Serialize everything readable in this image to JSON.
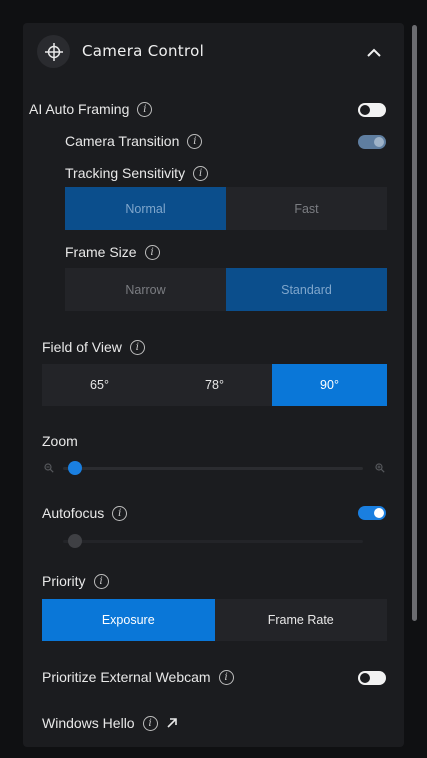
{
  "header": {
    "title": "Camera Control",
    "icon": "crosshair-icon",
    "collapse_icon": "chevron-up-icon"
  },
  "ai_auto_framing": {
    "label": "AI Auto Framing",
    "enabled": false,
    "camera_transition": {
      "label": "Camera Transition",
      "enabled": true,
      "disabled_look": true
    },
    "tracking_sensitivity": {
      "label": "Tracking Sensitivity",
      "options": [
        "Normal",
        "Fast"
      ],
      "selected": "Normal"
    },
    "frame_size": {
      "label": "Frame Size",
      "options": [
        "Narrow",
        "Standard"
      ],
      "selected": "Standard"
    }
  },
  "field_of_view": {
    "label": "Field of View",
    "options": [
      "65°",
      "78°",
      "90°"
    ],
    "selected": "90°"
  },
  "zoom": {
    "label": "Zoom",
    "value_fraction": 0.0
  },
  "autofocus": {
    "label": "Autofocus",
    "enabled": true,
    "focus_value_fraction": 0.0
  },
  "priority": {
    "label": "Priority",
    "options": [
      "Exposure",
      "Frame Rate"
    ],
    "selected": "Exposure"
  },
  "prioritize_external_webcam": {
    "label": "Prioritize External Webcam",
    "enabled": false
  },
  "windows_hello": {
    "label": "Windows Hello",
    "link_icon": "external-link-arrow-icon"
  },
  "colors": {
    "accent": "#0a77d8",
    "accent_dim": "#0b4e8c",
    "panel_bg": "#1b1c1f",
    "segment_bg": "#232428"
  }
}
